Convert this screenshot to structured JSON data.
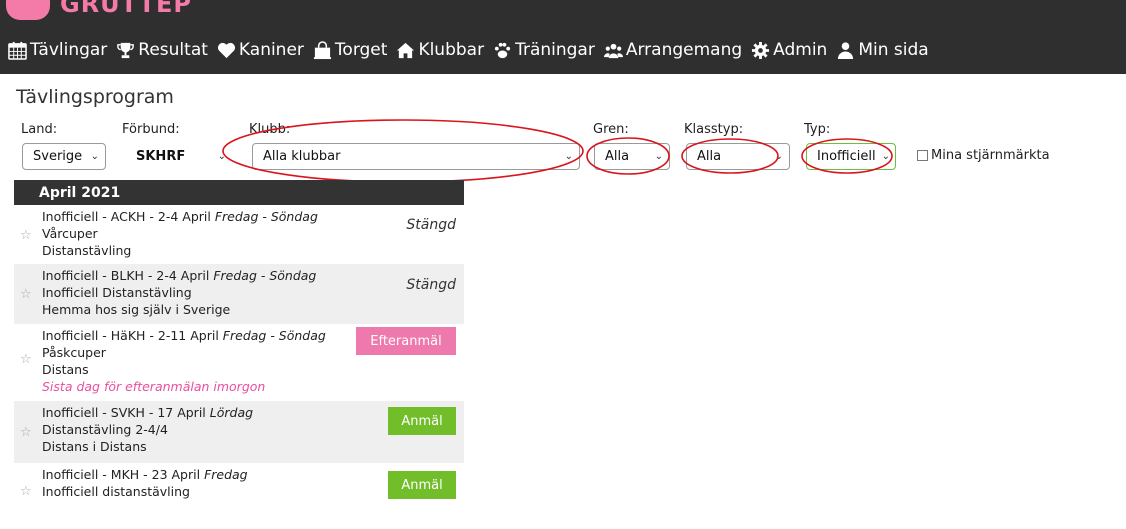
{
  "logo": {
    "text": "GRUTTEP"
  },
  "nav": [
    {
      "label": "Tävlingar",
      "icon": "calendar-icon"
    },
    {
      "label": "Resultat",
      "icon": "trophy-icon"
    },
    {
      "label": "Kaniner",
      "icon": "heart-icon"
    },
    {
      "label": "Torget",
      "icon": "shopping-bag-icon"
    },
    {
      "label": "Klubbar",
      "icon": "home-icon"
    },
    {
      "label": "Träningar",
      "icon": "paw-icon"
    },
    {
      "label": "Arrangemang",
      "icon": "group-icon"
    },
    {
      "label": "Admin",
      "icon": "gear-icon"
    },
    {
      "label": "Min sida",
      "icon": "user-icon"
    }
  ],
  "page": {
    "title": "Tävlingsprogram"
  },
  "filters": {
    "land": {
      "label": "Land:",
      "value": "Sverige"
    },
    "forbund": {
      "label": "Förbund:",
      "value": "SKHRF"
    },
    "klubb": {
      "label": "Klubb:",
      "value": "Alla klubbar"
    },
    "gren": {
      "label": "Gren:",
      "value": "Alla"
    },
    "klasstyp": {
      "label": "Klasstyp:",
      "value": "Alla"
    },
    "typ": {
      "label": "Typ:",
      "value": "Inofficiell"
    },
    "starred": {
      "label": "Mina stjärnmärkta"
    }
  },
  "month": "April 2021",
  "events": [
    {
      "head": "Inofficiell - ACKH - 2-4 April",
      "days": "Fredag - Söndag",
      "name": "Vårcuper",
      "sub": "Distanstävling",
      "note": "",
      "status": "Stängd",
      "action": ""
    },
    {
      "head": "Inofficiell - BLKH - 2-4 April",
      "days": "Fredag - Söndag",
      "name": "Inofficiell Distanstävling",
      "sub": "Hemma hos sig själv i Sverige",
      "note": "",
      "status": "Stängd",
      "action": ""
    },
    {
      "head": "Inofficiell - HäKH - 2-11 April",
      "days": "Fredag - Söndag",
      "name": "Påskcuper",
      "sub": "Distans",
      "note": "Sista dag för efteranmälan imorgon",
      "status": "",
      "action": "Efteranmäl"
    },
    {
      "head": "Inofficiell - SVKH - 17 April",
      "days": "Lördag",
      "name": "Distanstävling 2-4/4",
      "sub": "Distans i Distans",
      "note": "",
      "status": "",
      "action": "Anmäl"
    },
    {
      "head": "Inofficiell - MKH - 23 April",
      "days": "Fredag",
      "name": "Inofficiell distanstävling",
      "sub": "",
      "note": "",
      "status": "",
      "action": "Anmäl"
    }
  ],
  "colors": {
    "topbar": "#2f2f2f",
    "accent_pink": "#ee79ad",
    "accent_green": "#72bd2a",
    "annotation_red": "#d9141b"
  }
}
